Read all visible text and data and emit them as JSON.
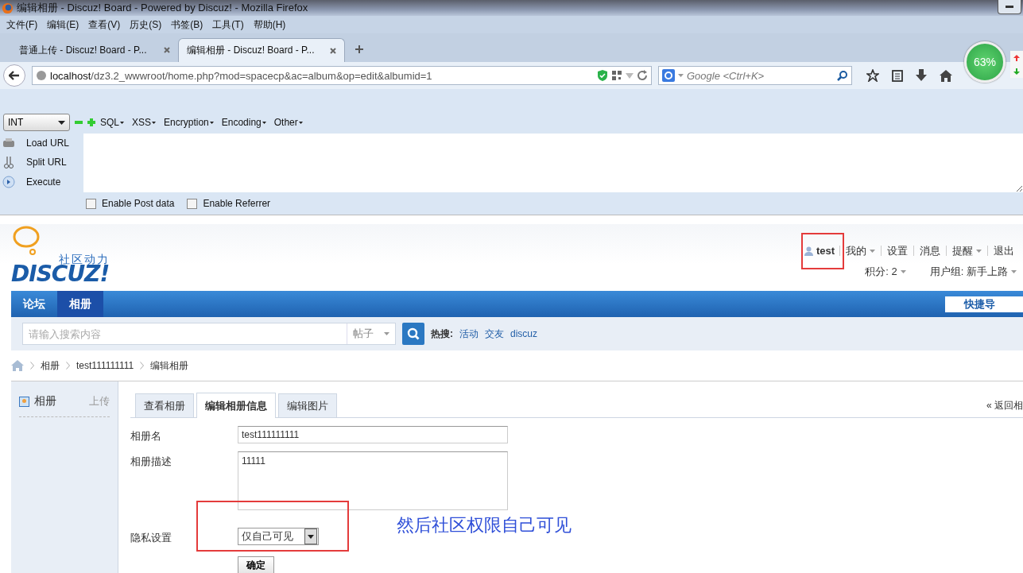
{
  "window": {
    "title": "编辑相册 - Discuz! Board - Powered by Discuz! - Mozilla Firefox"
  },
  "menu_bar": [
    "文件(F)",
    "编辑(E)",
    "查看(V)",
    "历史(S)",
    "书签(B)",
    "工具(T)",
    "帮助(H)"
  ],
  "tabs": [
    {
      "label": "普通上传 - Discuz! Board - P...",
      "selected": false
    },
    {
      "label": "编辑相册 - Discuz! Board - P...",
      "selected": true
    }
  ],
  "address_bar": {
    "url": "localhost/dz3.2_wwwroot/home.php?mod=spacecp&ac=album&op=edit&albumid=1"
  },
  "search_bar": {
    "placeholder": "Google <Ctrl+K>"
  },
  "speed_gauge": {
    "percent": "63%"
  },
  "hackbar": {
    "select": "INT",
    "menus": [
      "SQL",
      "XSS",
      "Encryption",
      "Encoding",
      "Other"
    ],
    "actions": [
      "Load URL",
      "Split URL",
      "Execute"
    ],
    "checkboxes": [
      {
        "label": "Enable Post data",
        "checked": false
      },
      {
        "label": "Enable Referrer",
        "checked": false
      }
    ]
  },
  "site_header": {
    "tagline": "社区动力",
    "wordmark": "DISCUZ!",
    "username": "test",
    "user_links": [
      {
        "label": "我的",
        "dropdown": true
      },
      {
        "label": "设置",
        "dropdown": false
      },
      {
        "label": "消息",
        "dropdown": false
      },
      {
        "label": "提醒",
        "dropdown": true
      },
      {
        "label": "退出",
        "dropdown": false
      }
    ],
    "credits": "积分: 2",
    "user_group": "用户组: 新手上路"
  },
  "nav": {
    "items": [
      {
        "label": "论坛",
        "selected": false
      },
      {
        "label": "相册",
        "selected": true
      }
    ],
    "quick_nav": "快捷导"
  },
  "site_search": {
    "placeholder": "请输入搜索内容",
    "type": "帖子",
    "hot_label": "热搜:",
    "hot_terms": [
      "活动",
      "交友",
      "discuz"
    ]
  },
  "breadcrumb": [
    "相册",
    "test111111111",
    "编辑相册"
  ],
  "sidebar": {
    "title": "相册",
    "action": "上传"
  },
  "content_tabs": [
    {
      "label": "查看相册",
      "selected": false
    },
    {
      "label": "编辑相册信息",
      "selected": true
    },
    {
      "label": "编辑图片",
      "selected": false
    }
  ],
  "back_link": "« 返回相",
  "form": {
    "fields": [
      {
        "label": "相册名",
        "kind": "text",
        "value": "test111111111"
      },
      {
        "label": "相册描述",
        "kind": "textarea",
        "value": "11111"
      },
      {
        "label": "隐私设置",
        "kind": "select",
        "value": "仅自己可见"
      }
    ],
    "submit": "确定"
  },
  "annotation": "然后社区权限自己可见"
}
